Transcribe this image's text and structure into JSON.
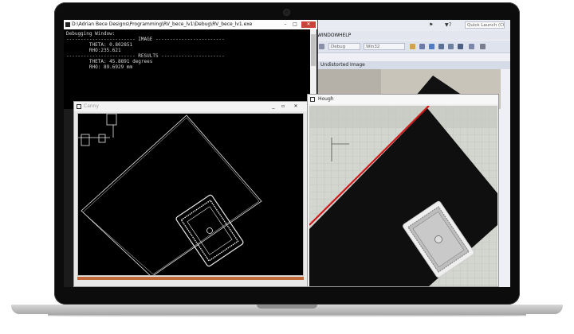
{
  "console_window": {
    "title": "D:\\Adrian Bece Designs\\Programming\\RV_bece_lv1\\Debug\\RV_bece_lv1.exe",
    "lines": [
      "Debugging Window:",
      "",
      "------------------------ IMAGE ------------------------",
      "",
      "        THETA: 0.802851",
      "        RHO:235.621",
      "",
      "------------------------ RESULTS ----------------------",
      "",
      "        THETA: 45.8891 degrees",
      "        RHO: 89.6929 mm"
    ],
    "minimize_label": "–",
    "maximize_label": "□",
    "close_label": "✕"
  },
  "vs": {
    "menu_window": "WINDOW",
    "menu_help": "HELP",
    "toolbar_debug": "Debug",
    "toolbar_platform": "Win32",
    "notification_count": "7",
    "quick_launch": "Quick Launch (Ctrl+Q)",
    "tab_title": "Undistorted Image"
  },
  "canny_window": {
    "title": "Canny"
  },
  "hough_window": {
    "title": "Hough"
  },
  "colors": {
    "hough_line": "#d01818",
    "card_border": "#dcdcdc",
    "black_box": "#0f0f10"
  }
}
